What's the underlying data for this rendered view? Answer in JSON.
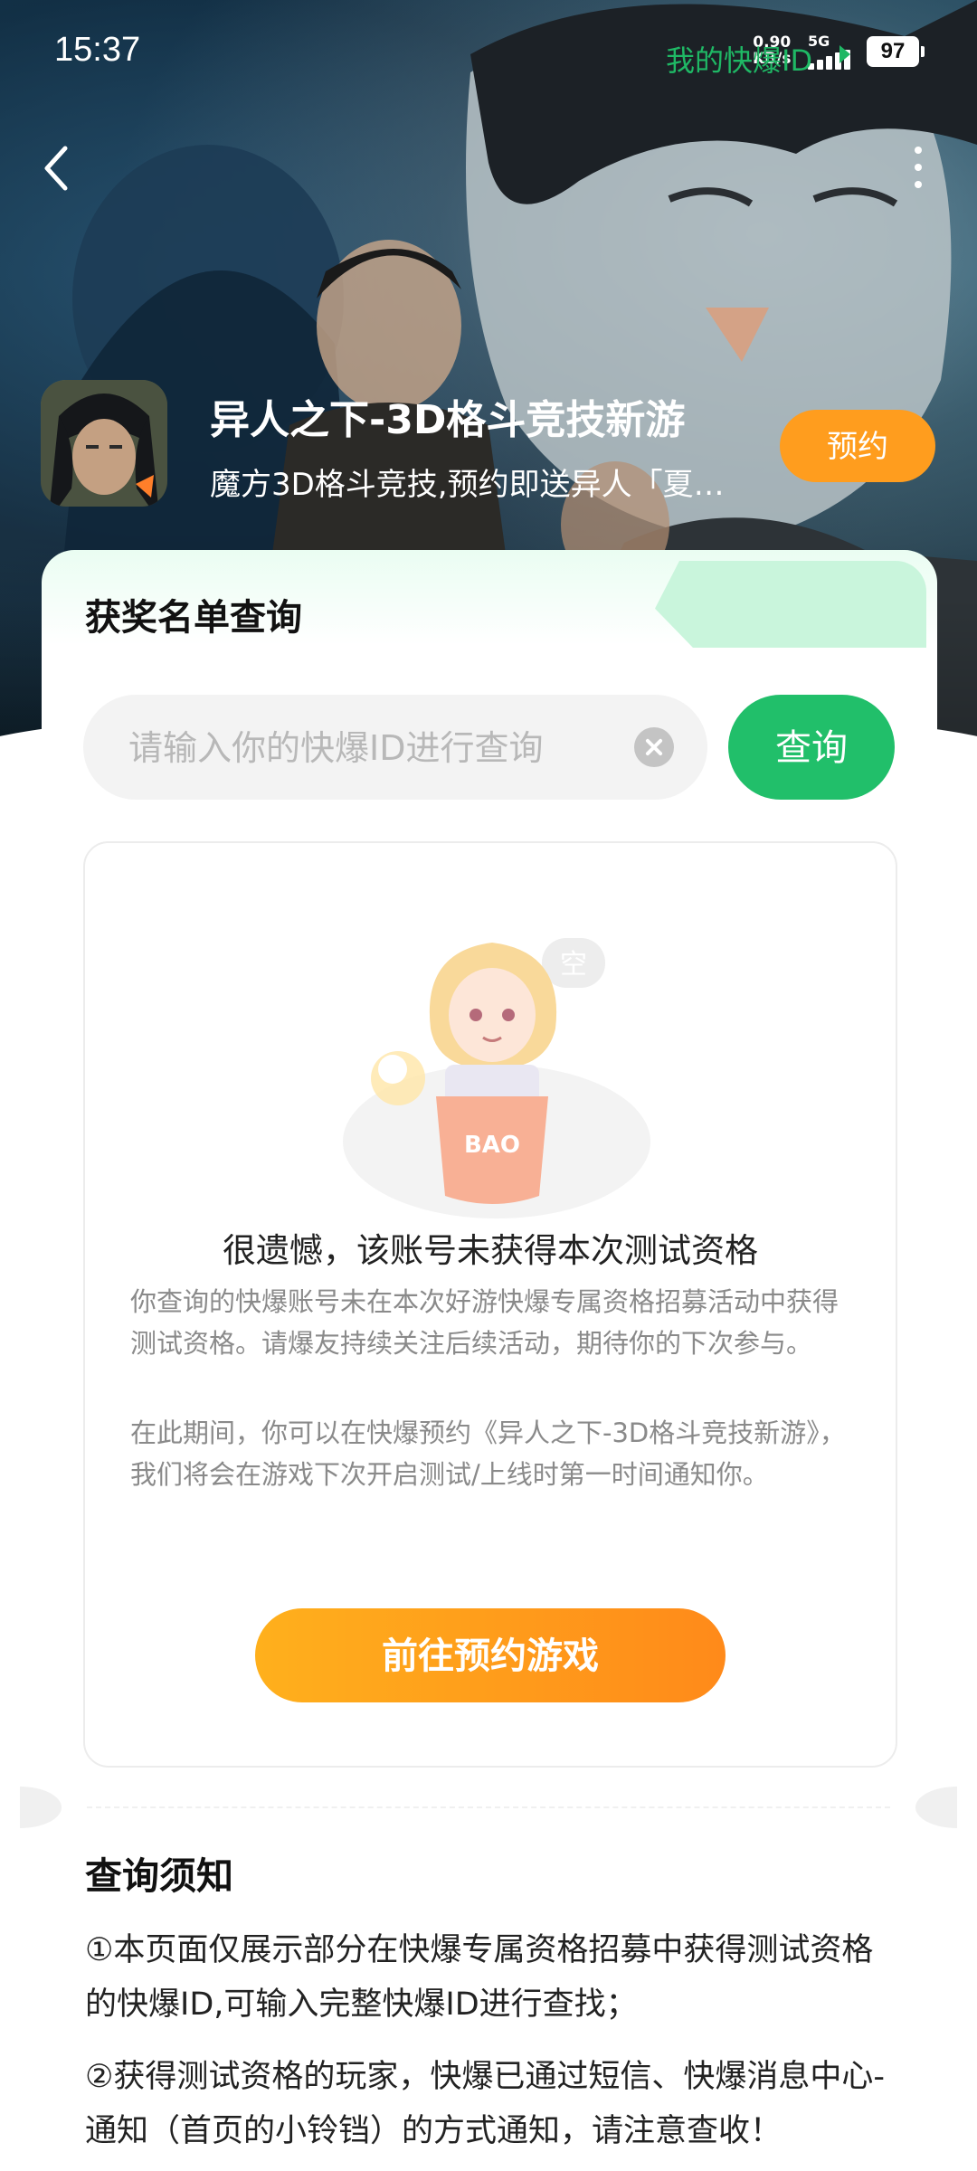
{
  "status_bar": {
    "time": "15:37",
    "net_speed_value": "0.90",
    "net_speed_unit": "KB/s",
    "network": "5G",
    "battery": "97"
  },
  "game": {
    "title": "异人之下-3D格斗竞技新游",
    "subtitle": "魔方3D格斗竞技,预约即送异人「夏…",
    "reserve_label": "预约"
  },
  "query": {
    "title": "获奖名单查询",
    "my_id_label": "我的快爆ID",
    "placeholder": "请输入你的快爆ID进行查询",
    "value": "",
    "button_label": "查询"
  },
  "result": {
    "illustration_badge": "空",
    "illustration_box_text": "BAO",
    "title": "很遗憾，该账号未获得本次测试资格",
    "desc1": "你查询的快爆账号未在本次好游快爆专属资格招募活动中获得测试资格。请爆友持续关注后续活动，期待你的下次参与。",
    "desc2": "在此期间，你可以在快爆预约《异人之下-3D格斗竞技新游》，我们将会在游戏下次开启测试/上线时第一时间通知你。",
    "button_label": "前往预约游戏"
  },
  "notice": {
    "title": "查询须知",
    "items": [
      "①本页面仅展示部分在快爆专属资格招募中获得测试资格的快爆ID,可输入完整快爆ID进行查找；",
      "②获得测试资格的玩家，快爆已通过短信、快爆消息中心-通知（首页的小铃铛）的方式通知，请注意查收！"
    ]
  },
  "colors": {
    "primary_green": "#21bf6a",
    "accent_orange": "#ff9d1e",
    "hero_bg": "#184e66"
  }
}
